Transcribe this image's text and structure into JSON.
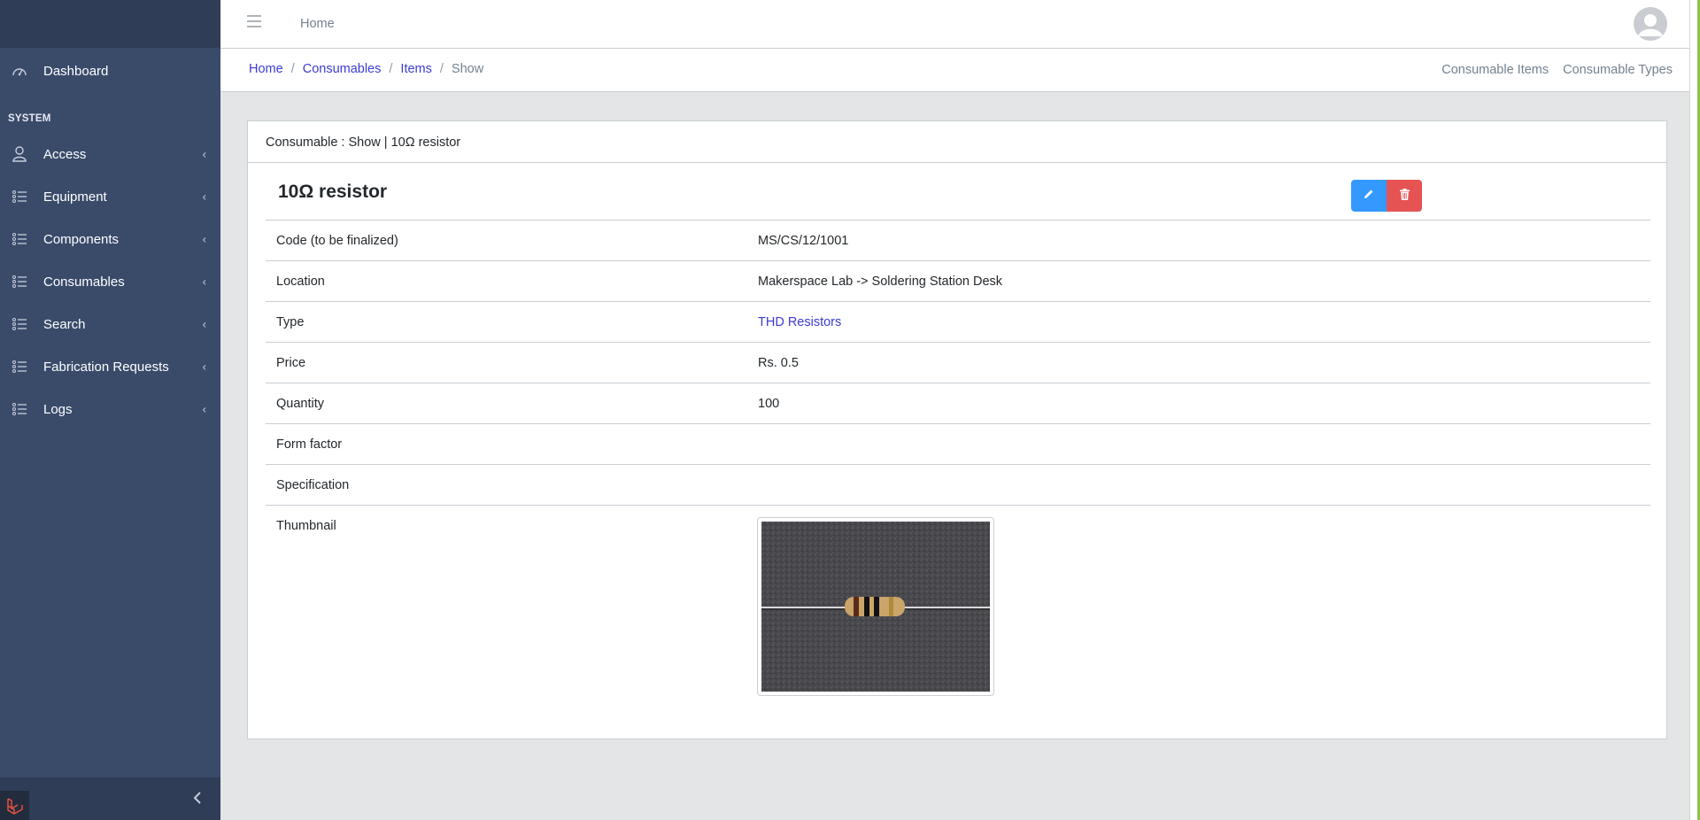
{
  "sidebar": {
    "dashboard_label": "Dashboard",
    "section_title": "SYSTEM",
    "items": [
      {
        "label": "Access",
        "icon": "user-icon"
      },
      {
        "label": "Equipment",
        "icon": "list-icon"
      },
      {
        "label": "Components",
        "icon": "list-icon"
      },
      {
        "label": "Consumables",
        "icon": "list-icon"
      },
      {
        "label": "Search",
        "icon": "list-icon"
      },
      {
        "label": "Fabrication Requests",
        "icon": "list-icon"
      },
      {
        "label": "Logs",
        "icon": "list-icon"
      }
    ]
  },
  "header": {
    "home_link": "Home"
  },
  "breadcrumb": {
    "items": [
      "Home",
      "Consumables",
      "Items"
    ],
    "active": "Show",
    "separator": "/",
    "menu": [
      "Consumable Items",
      "Consumable Types"
    ]
  },
  "card": {
    "header": "Consumable : Show | 10Ω resistor",
    "title": "10Ω resistor",
    "rows": [
      {
        "key": "Code (to be finalized)",
        "value": "MS/CS/12/1001"
      },
      {
        "key": "Location",
        "value": "Makerspace Lab -> Soldering Station Desk"
      },
      {
        "key": "Type",
        "value": "THD Resistors"
      },
      {
        "key": "Price",
        "value": "Rs. 0.5"
      },
      {
        "key": "Quantity",
        "value": "100"
      },
      {
        "key": "Form factor",
        "value": ""
      },
      {
        "key": "Specification",
        "value": ""
      },
      {
        "key": "Thumbnail",
        "value": ""
      }
    ]
  },
  "colors": {
    "sidebar_bg": "#3a4b6a",
    "link": "#3b3bd6",
    "edit_button": "#3399ff",
    "delete_button": "#e55353"
  }
}
